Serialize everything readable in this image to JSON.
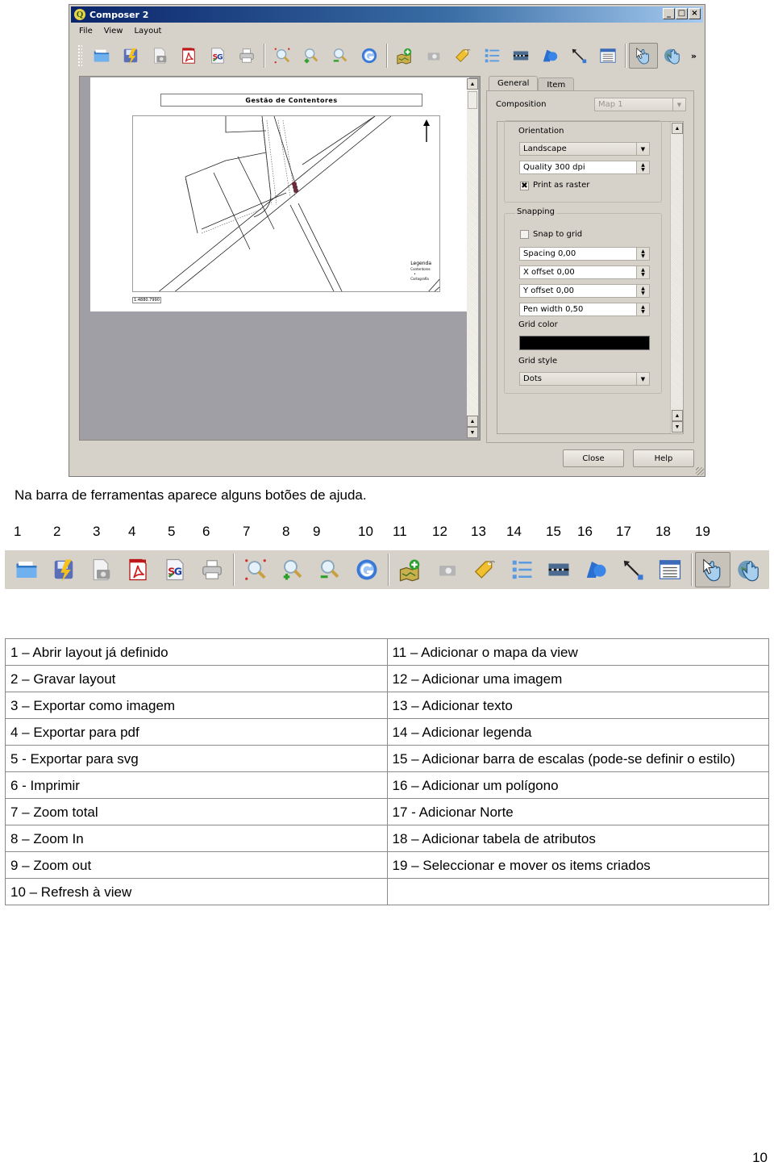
{
  "window": {
    "title": "Composer 2",
    "controls": [
      "_",
      "□",
      "×"
    ],
    "menu": [
      "File",
      "View",
      "Layout"
    ],
    "toolbar_overflow": "»",
    "toolbar_icons": [
      "open-layout-icon",
      "save-layout-icon",
      "export-image-icon",
      "export-pdf-icon",
      "export-svg-icon",
      "print-icon",
      "zoom-full-icon",
      "zoom-in-icon",
      "zoom-out-icon",
      "refresh-icon",
      "add-map-icon",
      "add-image-icon",
      "add-label-icon",
      "add-legend-icon",
      "add-scalebar-icon",
      "add-shape-icon",
      "add-arrow-icon",
      "add-table-icon",
      "select-move-icon",
      "move-content-icon"
    ],
    "active_tool_index": 18
  },
  "canvas": {
    "map_title": "Gestão de Contentores",
    "scale_label": "1:4880.7990",
    "legend_title": "Legenda",
    "legend_items": [
      "Contentores",
      "Cartografia"
    ]
  },
  "panel": {
    "tabs": [
      "General",
      "Item"
    ],
    "active_tab": "General",
    "composition_label": "Composition",
    "composition_value": "Map 1",
    "orientation_label": "Orientation",
    "orientation_value": "Landscape",
    "quality_value": "Quality 300 dpi",
    "print_as_raster_label": "Print as raster",
    "print_as_raster_checked": true,
    "snapping_label": "Snapping",
    "snap_to_grid_label": "Snap to grid",
    "snap_to_grid_checked": false,
    "spacing_value": "Spacing 0,00",
    "x_offset_value": "X offset 0,00",
    "y_offset_value": "Y offset 0,00",
    "pen_width_value": "Pen width 0,50",
    "grid_color_label": "Grid color",
    "grid_color": "#000000",
    "grid_style_label": "Grid style",
    "grid_style_value": "Dots",
    "close_label": "Close",
    "help_label": "Help"
  },
  "document": {
    "intro": "Na barra de ferramentas aparece alguns botões de ajuda.",
    "numbers": [
      "1",
      "2",
      "3",
      "4",
      "5",
      "6",
      "7",
      "8",
      "9",
      "10",
      "11",
      "12",
      "13",
      "14",
      "15",
      "16",
      "17",
      "18",
      "19"
    ],
    "table": [
      [
        "1 – Abrir layout já definido",
        "11 – Adicionar o mapa da view"
      ],
      [
        "2 – Gravar layout",
        "12 – Adicionar uma imagem"
      ],
      [
        "3 – Exportar como imagem",
        "13 – Adicionar texto"
      ],
      [
        "4 – Exportar para pdf",
        "14 – Adicionar legenda"
      ],
      [
        "5 -  Exportar para svg",
        "15 – Adicionar barra de escalas (pode-se definir o estilo)"
      ],
      [
        "6 - Imprimir",
        "16 – Adicionar um polígono"
      ],
      [
        "7 – Zoom total",
        "17 -  Adicionar Norte"
      ],
      [
        "8 – Zoom In",
        "18 – Adicionar tabela de atributos"
      ],
      [
        "9 – Zoom out",
        "19 – Seleccionar e mover os items criados"
      ],
      [
        "10 – Refresh à view",
        ""
      ]
    ],
    "page_number": "10"
  }
}
